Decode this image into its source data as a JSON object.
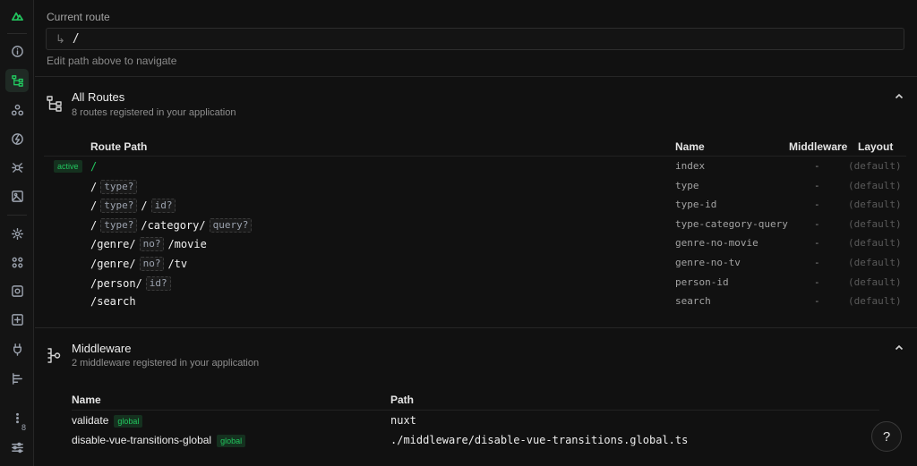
{
  "sidebar": {
    "icons": [
      "nuxt-logo-icon",
      "info-icon",
      "routes-icon",
      "components-icon",
      "imports-icon",
      "modules-icon",
      "assets-icon",
      "settings-icon",
      "plugins-icon",
      "runtime-config-icon",
      "payload-icon",
      "hooks-icon",
      "timeline-icon",
      "more-icon",
      "preferences-icon"
    ],
    "more_count": "8",
    "accent": "#22c55e"
  },
  "current_route": {
    "label": "Current route",
    "arrow": "↳",
    "value": "/",
    "hint": "Edit path above to navigate"
  },
  "routes_section": {
    "title": "All Routes",
    "subtitle": "8 routes registered in your application",
    "headers": {
      "path": "Route Path",
      "name": "Name",
      "middleware": "Middleware",
      "layout": "Layout"
    },
    "active_label": "active",
    "rows": [
      {
        "segments": [
          {
            "t": "text",
            "v": "/"
          }
        ],
        "name": "index",
        "middleware": "-",
        "layout": "(default)",
        "active": true
      },
      {
        "segments": [
          {
            "t": "text",
            "v": "/"
          },
          {
            "t": "param",
            "v": "type?"
          }
        ],
        "name": "type",
        "middleware": "-",
        "layout": "(default)"
      },
      {
        "segments": [
          {
            "t": "text",
            "v": "/"
          },
          {
            "t": "param",
            "v": "type?"
          },
          {
            "t": "text",
            "v": "/"
          },
          {
            "t": "param",
            "v": "id?"
          }
        ],
        "name": "type-id",
        "middleware": "-",
        "layout": "(default)"
      },
      {
        "segments": [
          {
            "t": "text",
            "v": "/"
          },
          {
            "t": "param",
            "v": "type?"
          },
          {
            "t": "text",
            "v": "/category/"
          },
          {
            "t": "param",
            "v": "query?"
          }
        ],
        "name": "type-category-query",
        "middleware": "-",
        "layout": "(default)"
      },
      {
        "segments": [
          {
            "t": "text",
            "v": "/genre/"
          },
          {
            "t": "param",
            "v": "no?"
          },
          {
            "t": "text",
            "v": "/movie"
          }
        ],
        "name": "genre-no-movie",
        "middleware": "-",
        "layout": "(default)"
      },
      {
        "segments": [
          {
            "t": "text",
            "v": "/genre/"
          },
          {
            "t": "param",
            "v": "no?"
          },
          {
            "t": "text",
            "v": "/tv"
          }
        ],
        "name": "genre-no-tv",
        "middleware": "-",
        "layout": "(default)"
      },
      {
        "segments": [
          {
            "t": "text",
            "v": "/person/"
          },
          {
            "t": "param",
            "v": "id?"
          }
        ],
        "name": "person-id",
        "middleware": "-",
        "layout": "(default)"
      },
      {
        "segments": [
          {
            "t": "text",
            "v": "/search"
          }
        ],
        "name": "search",
        "middleware": "-",
        "layout": "(default)"
      }
    ]
  },
  "middleware_section": {
    "title": "Middleware",
    "subtitle": "2 middleware registered in your application",
    "headers": {
      "name": "Name",
      "path": "Path"
    },
    "rows": [
      {
        "name": "validate",
        "badge": "global",
        "path": "nuxt"
      },
      {
        "name": "disable-vue-transitions-global",
        "badge": "global",
        "path": "./middleware/disable-vue-transitions.global.ts"
      }
    ]
  },
  "help": {
    "label": "?"
  }
}
